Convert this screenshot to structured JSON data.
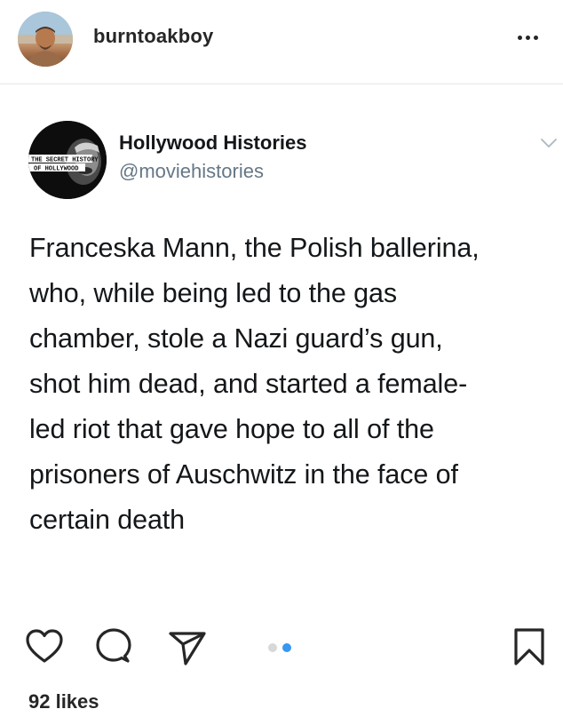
{
  "post": {
    "username": "burntoakboy",
    "avatar_icon": "user-avatar-photo",
    "more_icon": "more-horizontal-icon",
    "likes_text": "92 likes"
  },
  "tweet": {
    "display_name": "Hollywood Histories",
    "handle": "@moviehistories",
    "avatar_text_line1": "THE SECRET HISTORY",
    "avatar_text_line2": "OF HOLLYWOOD",
    "body": "Franceska Mann, the Polish ballerina,\nwho, while being led to the gas\nchamber, stole a Nazi guard’s gun,\nshot him dead, and started a female-\nled riot that gave hope to all of the\nprisoners of Auschwitz in the face of\ncertain death"
  },
  "actions": {
    "icons": [
      "heart-icon",
      "comment-icon",
      "share-icon",
      "bookmark-icon"
    ],
    "carousel": {
      "total": 2,
      "active_index": 2
    }
  },
  "colors": {
    "text": "#262626",
    "tweet_text": "#14171a",
    "handle": "#657786",
    "carousel_active": "#3897f0",
    "carousel_inactive": "#d8d8d8",
    "divider": "#e6e6e6"
  }
}
